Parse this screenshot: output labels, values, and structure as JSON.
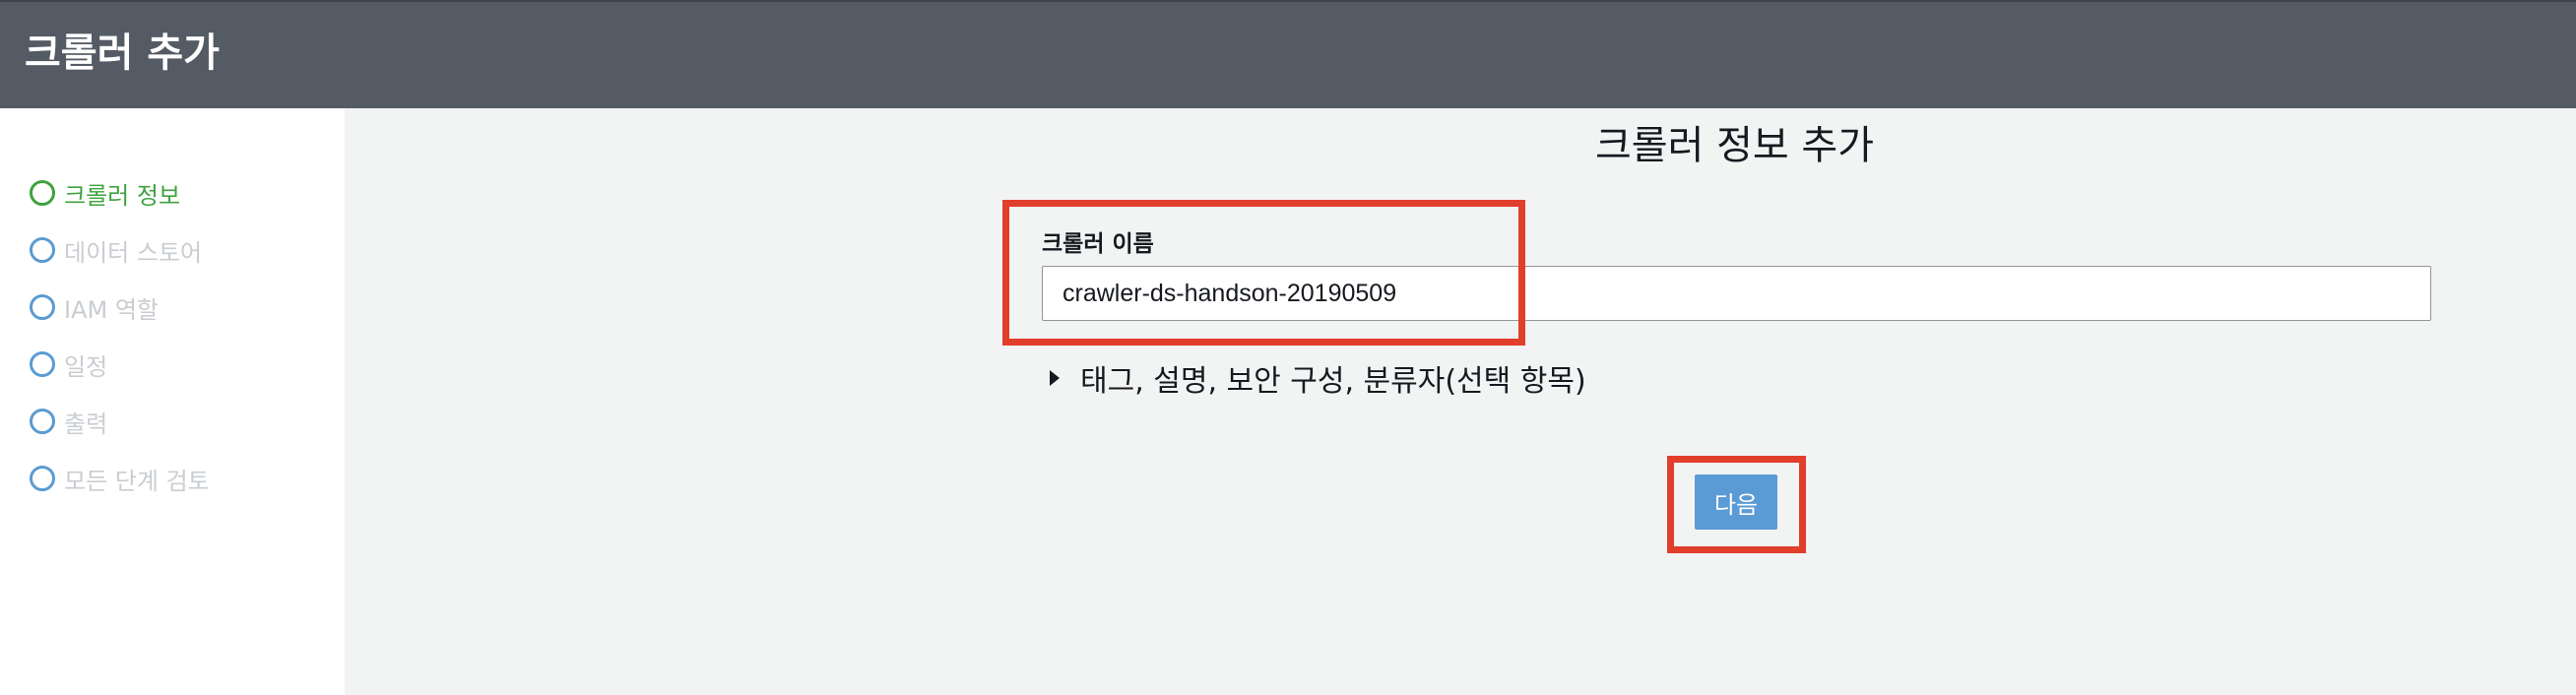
{
  "header": {
    "title": "크롤러 추가"
  },
  "sidebar": {
    "steps": [
      {
        "label": "크롤러 정보",
        "state": "active"
      },
      {
        "label": "데이터 스토어",
        "state": "pending"
      },
      {
        "label": "IAM 역할",
        "state": "pending"
      },
      {
        "label": "일정",
        "state": "pending"
      },
      {
        "label": "출력",
        "state": "pending"
      },
      {
        "label": "모든 단계 검토",
        "state": "pending"
      }
    ]
  },
  "main": {
    "title": "크롤러 정보 추가",
    "crawler_name": {
      "label": "크롤러 이름",
      "value": "crawler-ds-handson-20190509"
    },
    "optional_section": {
      "label": "태그, 설명, 보안 구성, 분류자(선택 항목)",
      "expanded": false
    },
    "next_button": {
      "label": "다음"
    }
  },
  "colors": {
    "header_bg": "#545b64",
    "main_bg": "#f2f3f3",
    "active_step": "#3fa23f",
    "pending_step_circle": "#5b9bd1",
    "pending_step_text": "#c9cdd1",
    "primary_button": "#5b9bd5",
    "highlight": "#e23e2c"
  },
  "icons": {
    "expander": "caret-right-icon",
    "step": "circle-icon"
  }
}
